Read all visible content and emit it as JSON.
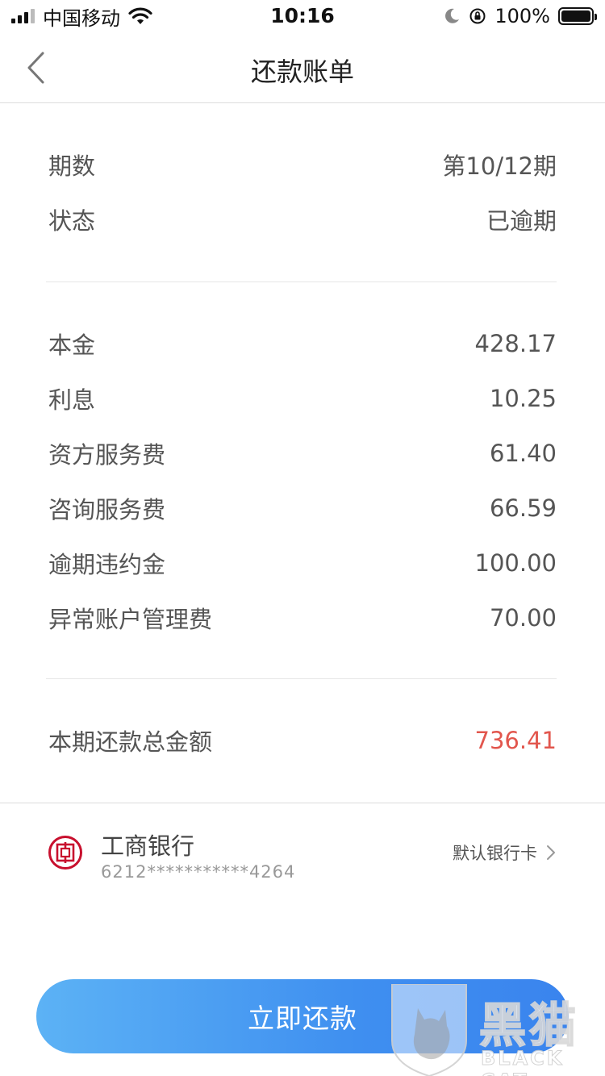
{
  "status_bar": {
    "carrier": "中国移动",
    "time": "10:16",
    "battery": "100%"
  },
  "nav": {
    "title": "还款账单"
  },
  "period_info": {
    "period_label": "期数",
    "period_value": "第10/12期",
    "status_label": "状态",
    "status_value": "已逾期"
  },
  "fees": [
    {
      "label": "本金",
      "value": "428.17"
    },
    {
      "label": "利息",
      "value": "10.25"
    },
    {
      "label": "资方服务费",
      "value": "61.40"
    },
    {
      "label": "咨询服务费",
      "value": "66.59"
    },
    {
      "label": "逾期违约金",
      "value": "100.00"
    },
    {
      "label": "异常账户管理费",
      "value": "70.00"
    }
  ],
  "total": {
    "label": "本期还款总金额",
    "value": "736.41",
    "color": "#e2564d"
  },
  "bank_card": {
    "name": "工商银行",
    "card_number": "6212***********4264",
    "default_label": "默认银行卡",
    "logo_color": "#c8102e"
  },
  "pay_button": {
    "label": "立即还款",
    "color": "#3f8ff0"
  },
  "watermark": {
    "cn": "黑猫",
    "en": "BLACK CAT"
  }
}
